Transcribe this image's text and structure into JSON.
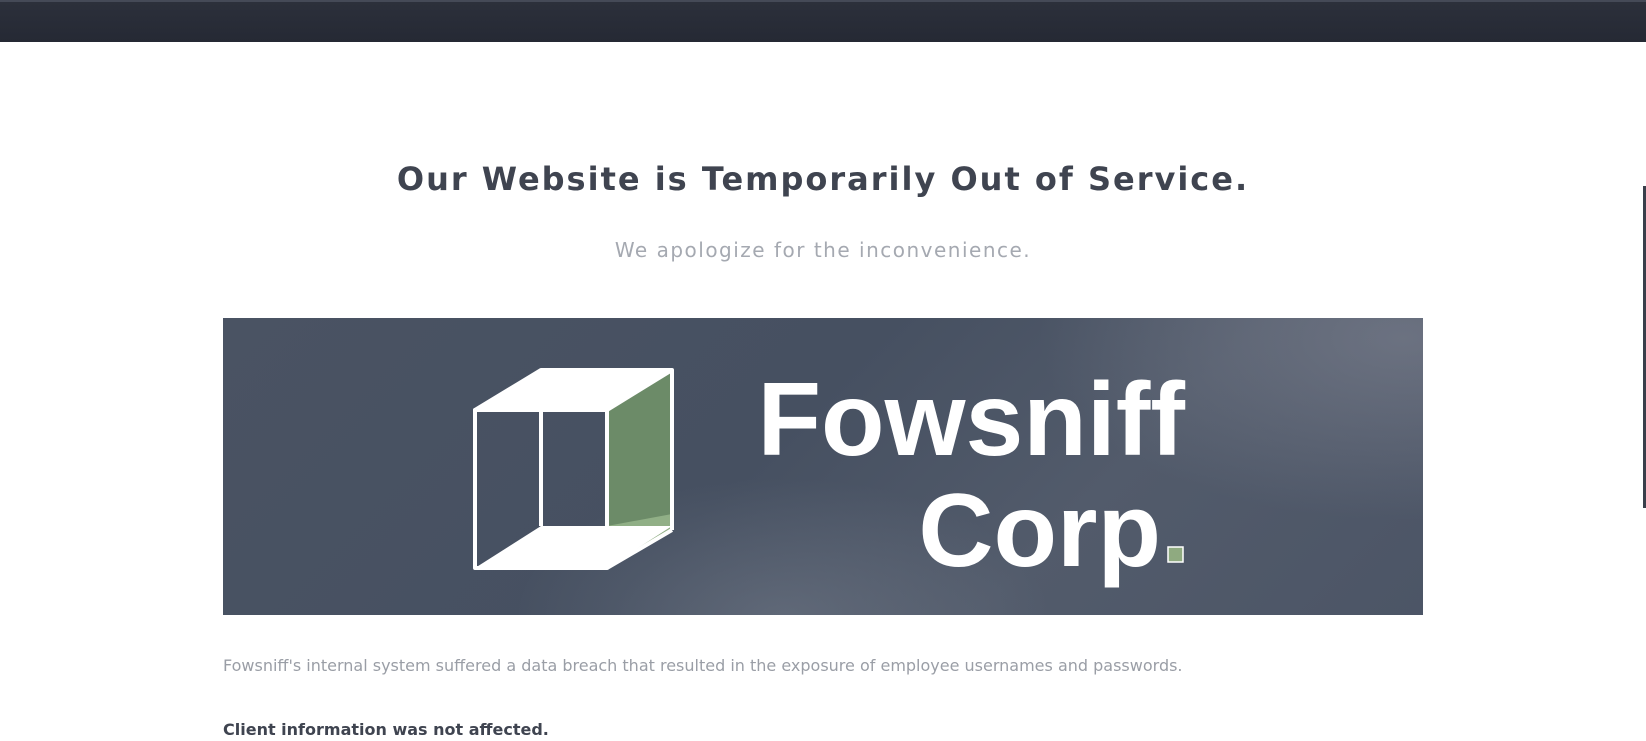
{
  "header": {
    "title": "Our Website is Temporarily Out of Service.",
    "subtitle": "We apologize for the inconvenience."
  },
  "banner": {
    "logo_line1": "Fowsniff",
    "logo_line2": "Corp",
    "logo_accent_color": "#8faa80",
    "cube_color": "#ffffff",
    "cube_face_color": "#6f8e68"
  },
  "content": {
    "breach_text": "Fowsniff's internal system suffered a data breach that resulted in the exposure of employee usernames and passwords.",
    "client_notice": "Client information was not affected."
  }
}
